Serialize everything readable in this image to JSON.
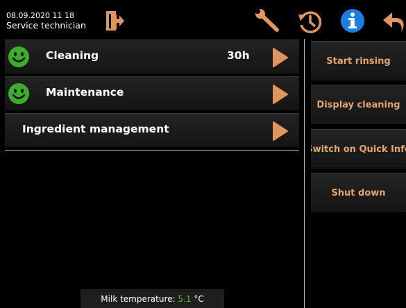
{
  "header": {
    "datetime": "08.09.2020 11 18",
    "role": "Service technician",
    "icons": [
      "logout-icon",
      "wrench-icon",
      "history-icon",
      "info-icon",
      "back-icon"
    ]
  },
  "menu": {
    "items": [
      {
        "label": "Cleaning",
        "value": "30h",
        "status_icon": "smiley-icon",
        "status_color": "#3dae2b"
      },
      {
        "label": "Maintenance",
        "value": "",
        "status_icon": "smiley-icon",
        "status_color": "#3dae2b"
      },
      {
        "label": "Ingredient management",
        "value": "",
        "status_icon": ""
      }
    ]
  },
  "actions": [
    {
      "label": "Start rinsing"
    },
    {
      "label": "Display cleaning"
    },
    {
      "label": "Switch on Quick Info"
    },
    {
      "label": "Shut down"
    }
  ],
  "status": {
    "milk_label": "Milk temperature:",
    "milk_value": "5.1",
    "milk_unit": "°C"
  },
  "colors": {
    "accent": "#e0955a",
    "button_text": "#e2a56a",
    "info_blue": "#1a7fe5",
    "ok_green": "#3dae2b",
    "value_green": "#5ec11a",
    "background": "#000000"
  }
}
